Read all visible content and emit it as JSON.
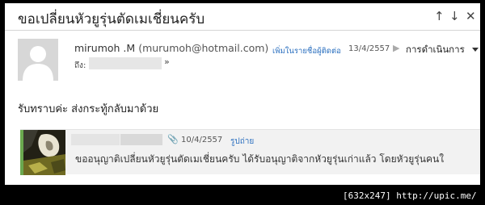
{
  "email": {
    "subject": "ขอเปลี่ยนหัวยูรุ่นตัดเมเชี่ยนครับ",
    "nav": {
      "up_icon": "↑",
      "down_icon": "↓",
      "close_icon": "✕"
    },
    "sender_name": "mirumoh .M",
    "sender_email": "(murumoh@hotmail.com)",
    "to_label": "ถึง:",
    "to_caret": "»",
    "add_contact": "เพิ่มในรายชื่อผู้ติดต่อ",
    "date": "13/4/2557",
    "actions_label": "การดำเนินการ",
    "body": "รับทราบค่ะ ส่งกระทู้กลับมาด้วย"
  },
  "quoted": {
    "date": "10/4/2557",
    "photo_link": "รูปถ่าย",
    "preview": "ขออนุญาติเปลี่ยนหัวยูรุ่นตัดเมเชี่ยนครับ ได้รับอนุญาติจากหัวยูรุ่นเก่าแล้ว โดยหัวยูรุ่นคนใ"
  },
  "watermark": "[632x247] http://upic.me/",
  "icons": [
    "arrow-up-icon",
    "arrow-down-icon",
    "close-icon",
    "avatar-placeholder-icon",
    "flag-icon",
    "chevron-down-icon",
    "paperclip-icon"
  ]
}
